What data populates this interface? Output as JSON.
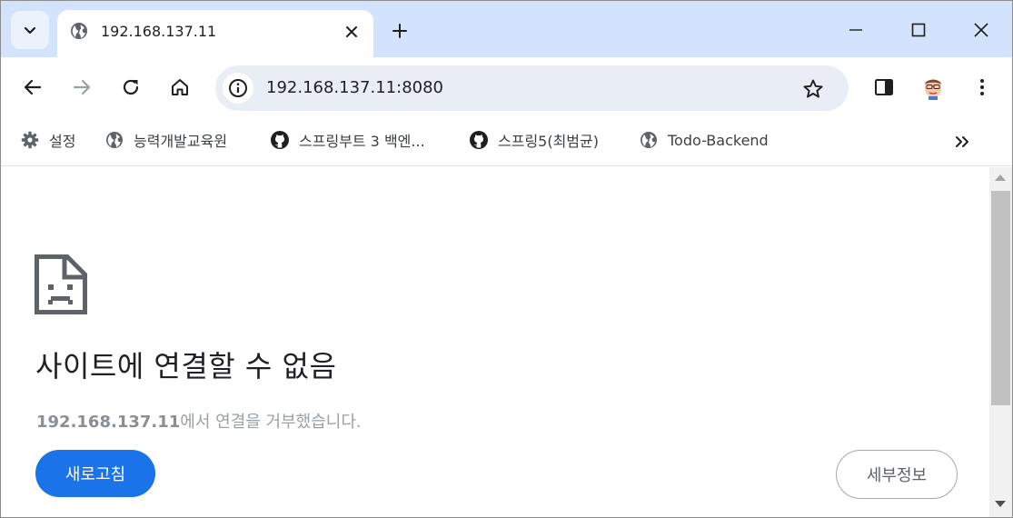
{
  "tab": {
    "title": "192.168.137.11",
    "favicon": "globe-icon"
  },
  "toolbar": {
    "url": "192.168.137.11:8080"
  },
  "bookmarks": [
    {
      "label": "설정",
      "icon": "gear-icon"
    },
    {
      "label": "능력개발교육원",
      "icon": "globe-icon"
    },
    {
      "label": "스프링부트 3 백엔...",
      "icon": "github-icon"
    },
    {
      "label": "스프링5(최범균)",
      "icon": "github-icon"
    },
    {
      "label": "Todo-Backend",
      "icon": "globe-icon"
    }
  ],
  "error": {
    "title": "사이트에 연결할 수 없음",
    "host": "192.168.137.11",
    "message": "에서 연결을 거부했습니다.",
    "reload_label": "새로고침",
    "details_label": "세부정보"
  },
  "colors": {
    "tabstrip": "#d3e3fd",
    "primary_button": "#1a73e8",
    "omnibox": "#e9eef6"
  }
}
